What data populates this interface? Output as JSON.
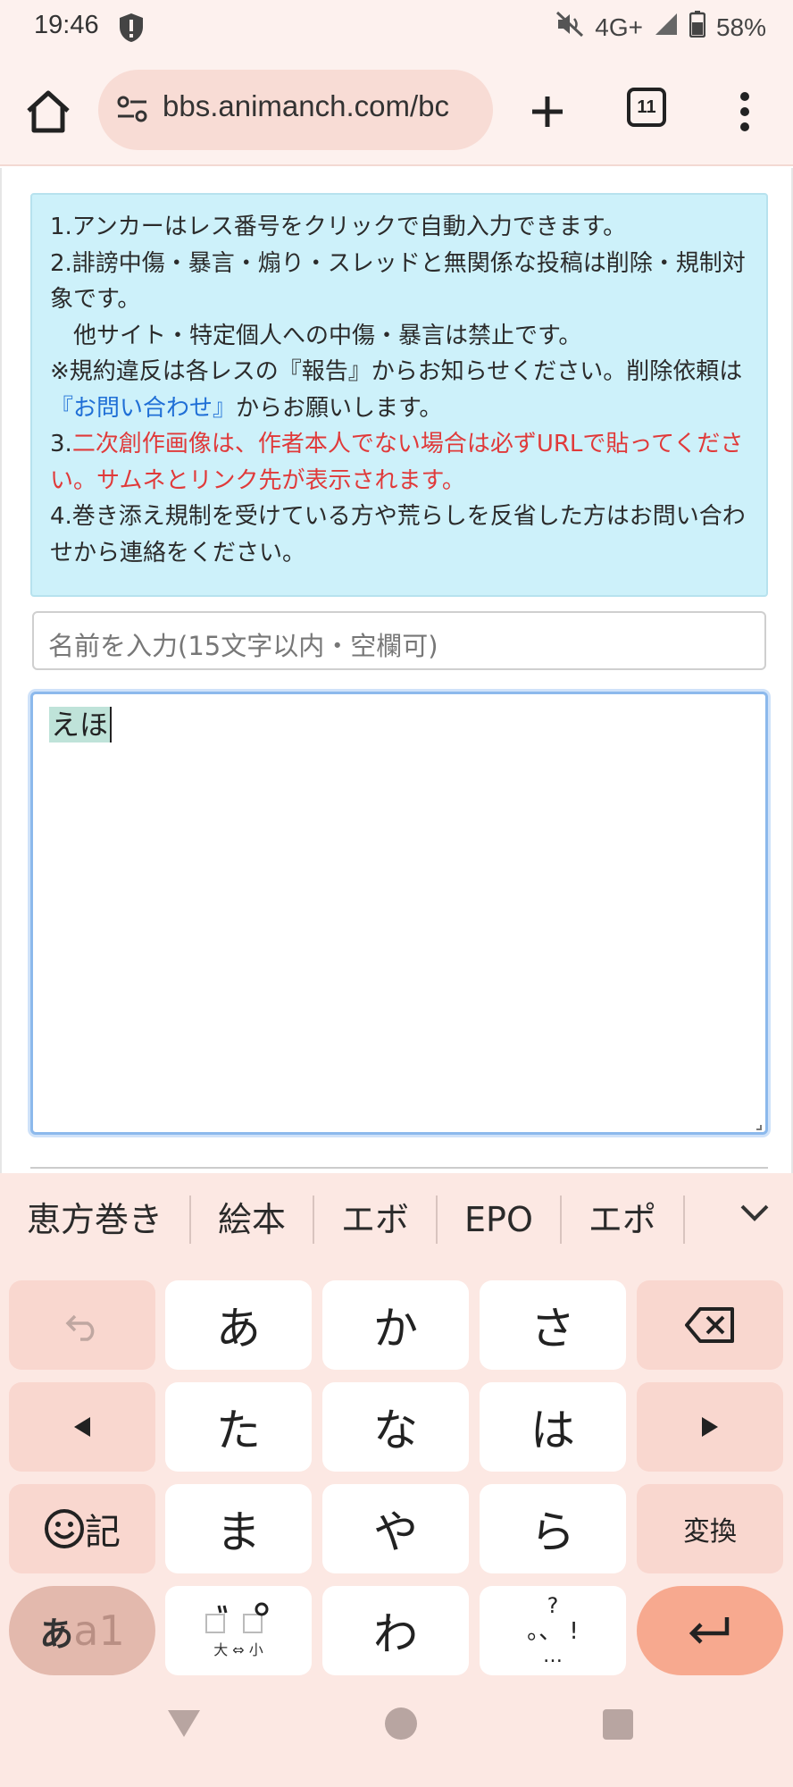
{
  "status_bar": {
    "time": "19:46",
    "network": "4G+",
    "battery": "58%"
  },
  "browser": {
    "url": "bbs.animanch.com/bc",
    "tab_count": "11"
  },
  "notice": {
    "line1": "1.アンカーはレス番号をクリックで自動入力できます。",
    "line2": "2.誹謗中傷・暴言・煽り・スレッドと無関係な投稿は削除・規制対象です。",
    "line3": "　他サイト・特定個人への中傷・暴言は禁止です。",
    "line4_pre": "※規約違反は各レスの『報告』からお知らせください。削除依頼は",
    "line4_link": "『お問い合わせ』",
    "line4_post": "からお願いします。",
    "line5_num": "3.",
    "line5_red": "二次創作画像は、作者本人でない場合は必ずURLで貼ってください。サムネとリンク先が表示されます。",
    "line6": "4.巻き添え規制を受けている方や荒らしを反省した方はお問い合わせから連絡をください。"
  },
  "form": {
    "name_placeholder": "名前を入力(15文字以内・空欄可)",
    "body_composing": "えほ"
  },
  "keyboard": {
    "suggestions": [
      "恵方巻き",
      "絵本",
      "エボ",
      "EPO",
      "エポ"
    ],
    "rows": [
      [
        "あ",
        "か",
        "さ"
      ],
      [
        "た",
        "な",
        "は"
      ],
      [
        "ま",
        "や",
        "ら"
      ],
      [
        "",
        "わ",
        ""
      ]
    ],
    "emoji_label": "記",
    "convert_label": "変換",
    "mode_label_a": "あ",
    "mode_label_b": "a1",
    "dakuten_label": "大 ⇔ 小",
    "punct_top": "?",
    "punct_mid": "。、 !",
    "punct_bottom": "…"
  }
}
